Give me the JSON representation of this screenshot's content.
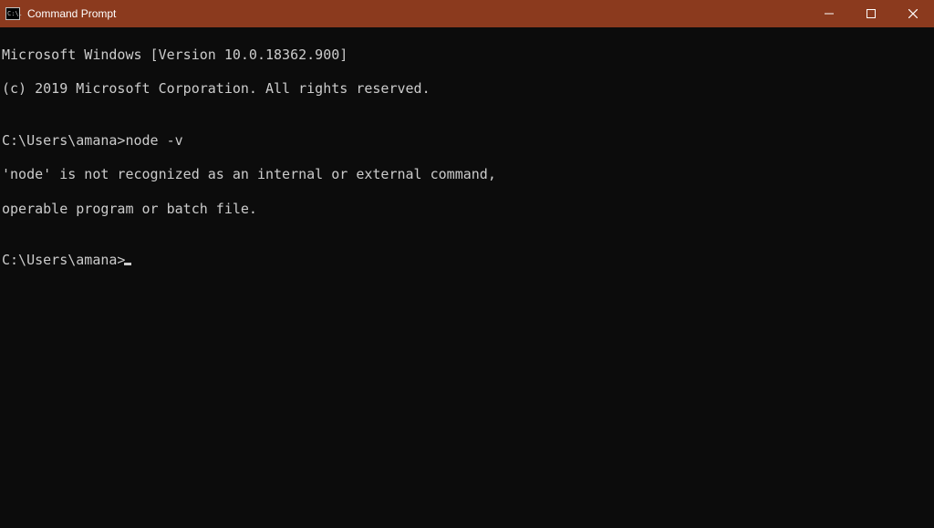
{
  "window": {
    "title": "Command Prompt",
    "icon_text": "C:\\."
  },
  "terminal": {
    "line1": "Microsoft Windows [Version 10.0.18362.900]",
    "line2": "(c) 2019 Microsoft Corporation. All rights reserved.",
    "blank1": "",
    "prompt1_path": "C:\\Users\\amana>",
    "prompt1_cmd": "node -v",
    "error1": "'node' is not recognized as an internal or external command,",
    "error2": "operable program or batch file.",
    "blank2": "",
    "prompt2_path": "C:\\Users\\amana>"
  }
}
